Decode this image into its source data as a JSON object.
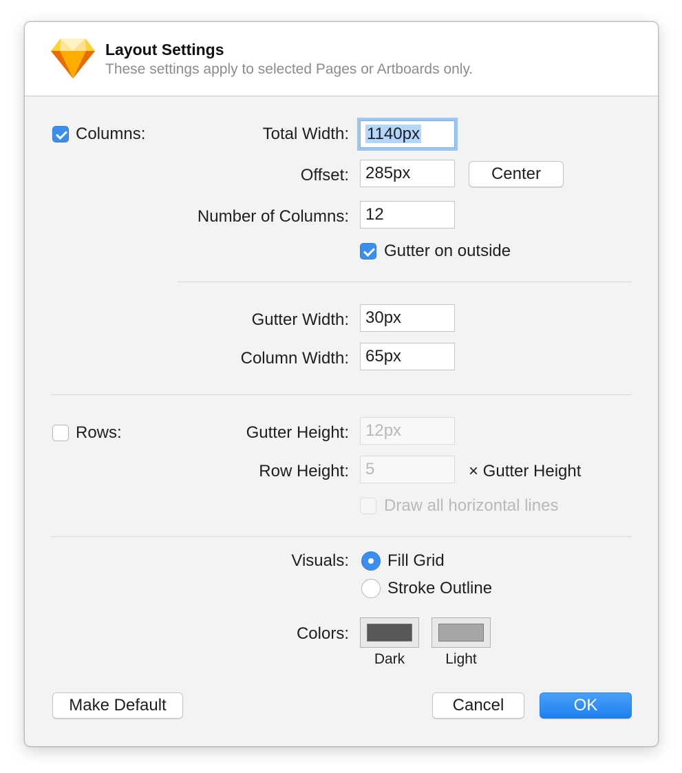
{
  "header": {
    "title": "Layout Settings",
    "subtitle": "These settings apply to selected Pages or Artboards only."
  },
  "columns": {
    "label": "Columns:",
    "enabled": true,
    "total_width_label": "Total Width:",
    "total_width_value": "1140px",
    "offset_label": "Offset:",
    "offset_value": "285px",
    "center_button": "Center",
    "number_label": "Number of Columns:",
    "number_value": "12",
    "gutter_outside_label": "Gutter on outside",
    "gutter_outside_checked": true,
    "gutter_width_label": "Gutter Width:",
    "gutter_width_value": "30px",
    "column_width_label": "Column Width:",
    "column_width_value": "65px"
  },
  "rows": {
    "label": "Rows:",
    "enabled": false,
    "gutter_height_label": "Gutter Height:",
    "gutter_height_value": "12px",
    "row_height_label": "Row Height:",
    "row_height_value": "5",
    "row_height_suffix": "× Gutter Height",
    "draw_lines_label": "Draw all horizontal lines",
    "draw_lines_checked": false
  },
  "visuals": {
    "label": "Visuals:",
    "options": [
      "Fill Grid",
      "Stroke Outline"
    ],
    "selected": "Fill Grid"
  },
  "colors": {
    "label": "Colors:",
    "dark_label": "Dark",
    "dark_color": "#585858",
    "light_label": "Light",
    "light_color": "#a6a6a6"
  },
  "buttons": {
    "make_default": "Make Default",
    "cancel": "Cancel",
    "ok": "OK"
  },
  "icons": {
    "app_logo": "sketch-diamond-icon"
  }
}
